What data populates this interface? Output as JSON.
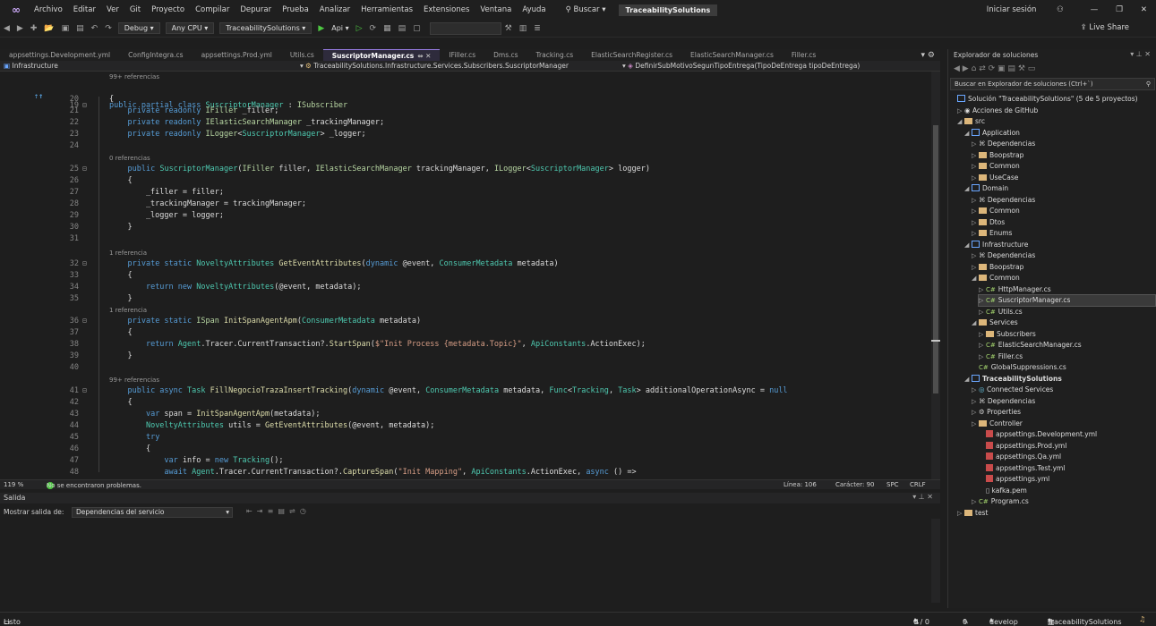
{
  "menu": [
    "Archivo",
    "Editar",
    "Ver",
    "Git",
    "Proyecto",
    "Compilar",
    "Depurar",
    "Prueba",
    "Analizar",
    "Herramientas",
    "Extensiones",
    "Ventana",
    "Ayuda"
  ],
  "search_label": "Buscar",
  "solution_name": "TraceabilitySolutions",
  "signin": "Iniciar sesión",
  "toolbar": {
    "config": "Debug",
    "platform": "Any CPU",
    "startup": "TraceabilitySolutions",
    "run_profile": "Api",
    "liveshare": "Live Share"
  },
  "tabs": [
    {
      "label": "appsettings.Development.yml",
      "active": false
    },
    {
      "label": "ConfigIntegra.cs",
      "active": false
    },
    {
      "label": "appsettings.Prod.yml",
      "active": false
    },
    {
      "label": "Utils.cs",
      "active": false
    },
    {
      "label": "SuscriptorManager.cs",
      "active": true
    },
    {
      "label": "IFiller.cs",
      "active": false
    },
    {
      "label": "Dms.cs",
      "active": false
    },
    {
      "label": "Tracking.cs",
      "active": false
    },
    {
      "label": "ElasticSearchRegister.cs",
      "active": false
    },
    {
      "label": "ElasticSearchManager.cs",
      "active": false
    },
    {
      "label": "Filler.cs",
      "active": false
    }
  ],
  "navbar": {
    "project": "Infrastructure",
    "class": "TraceabilitySolutions.Infrastructure.Services.Subscribers.SuscriptorManager",
    "member": "DefinirSubMotivoSegunTipoEntrega(TipoDeEntrega tipoDeEntrega)"
  },
  "refs": {
    "r99": "99+ referencias",
    "r0": "0 referencias",
    "r1": "1 referencia"
  },
  "line_numbers": [
    "19",
    "20",
    "21",
    "22",
    "23",
    "24",
    "25",
    "26",
    "27",
    "28",
    "29",
    "30",
    "31",
    "32",
    "33",
    "34",
    "35",
    "36",
    "37",
    "38",
    "39",
    "40",
    "41",
    "42",
    "43",
    "44",
    "45",
    "46",
    "47",
    "48"
  ],
  "editor_status": {
    "zoom": "119 %",
    "problems": "No se encontraron problemas.",
    "line": "Línea: 106",
    "char": "Carácter: 90",
    "spc": "SPC",
    "crlf": "CRLF"
  },
  "output": {
    "title": "Salida",
    "show_from_label": "Mostrar salida de:",
    "source": "Dependencias del servicio"
  },
  "solution_explorer": {
    "title": "Explorador de soluciones",
    "search_placeholder": "Buscar en Explorador de soluciones (Ctrl+`)",
    "nodes": [
      "Solución \"TraceabilitySolutions\" (5 de 5 proyectos)",
      "Acciones de GitHub",
      "src",
      "Application",
      "Dependencias",
      "Boopstrap",
      "Common",
      "UseCase",
      "Domain",
      "Dependencias",
      "Common",
      "Dtos",
      "Enums",
      "Infrastructure",
      "Dependencias",
      "Boopstrap",
      "Common",
      "HttpManager.cs",
      "SuscriptorManager.cs",
      "Utils.cs",
      "Services",
      "Subscribers",
      "ElasticSearchManager.cs",
      "Filler.cs",
      "GlobalSuppressions.cs",
      "TraceabilitySolutions",
      "Connected Services",
      "Dependencias",
      "Properties",
      "Controller",
      "appsettings.Development.yml",
      "appsettings.Prod.yml",
      "appsettings.Qa.yml",
      "appsettings.Test.yml",
      "appsettings.yml",
      "kafka.pem",
      "Program.cs",
      "test"
    ]
  },
  "statusbar": {
    "ready": "Listo",
    "changes": "0 / 0",
    "pencil_count": "0",
    "branch": "develop",
    "repo": "TraceabilitySolutions"
  }
}
